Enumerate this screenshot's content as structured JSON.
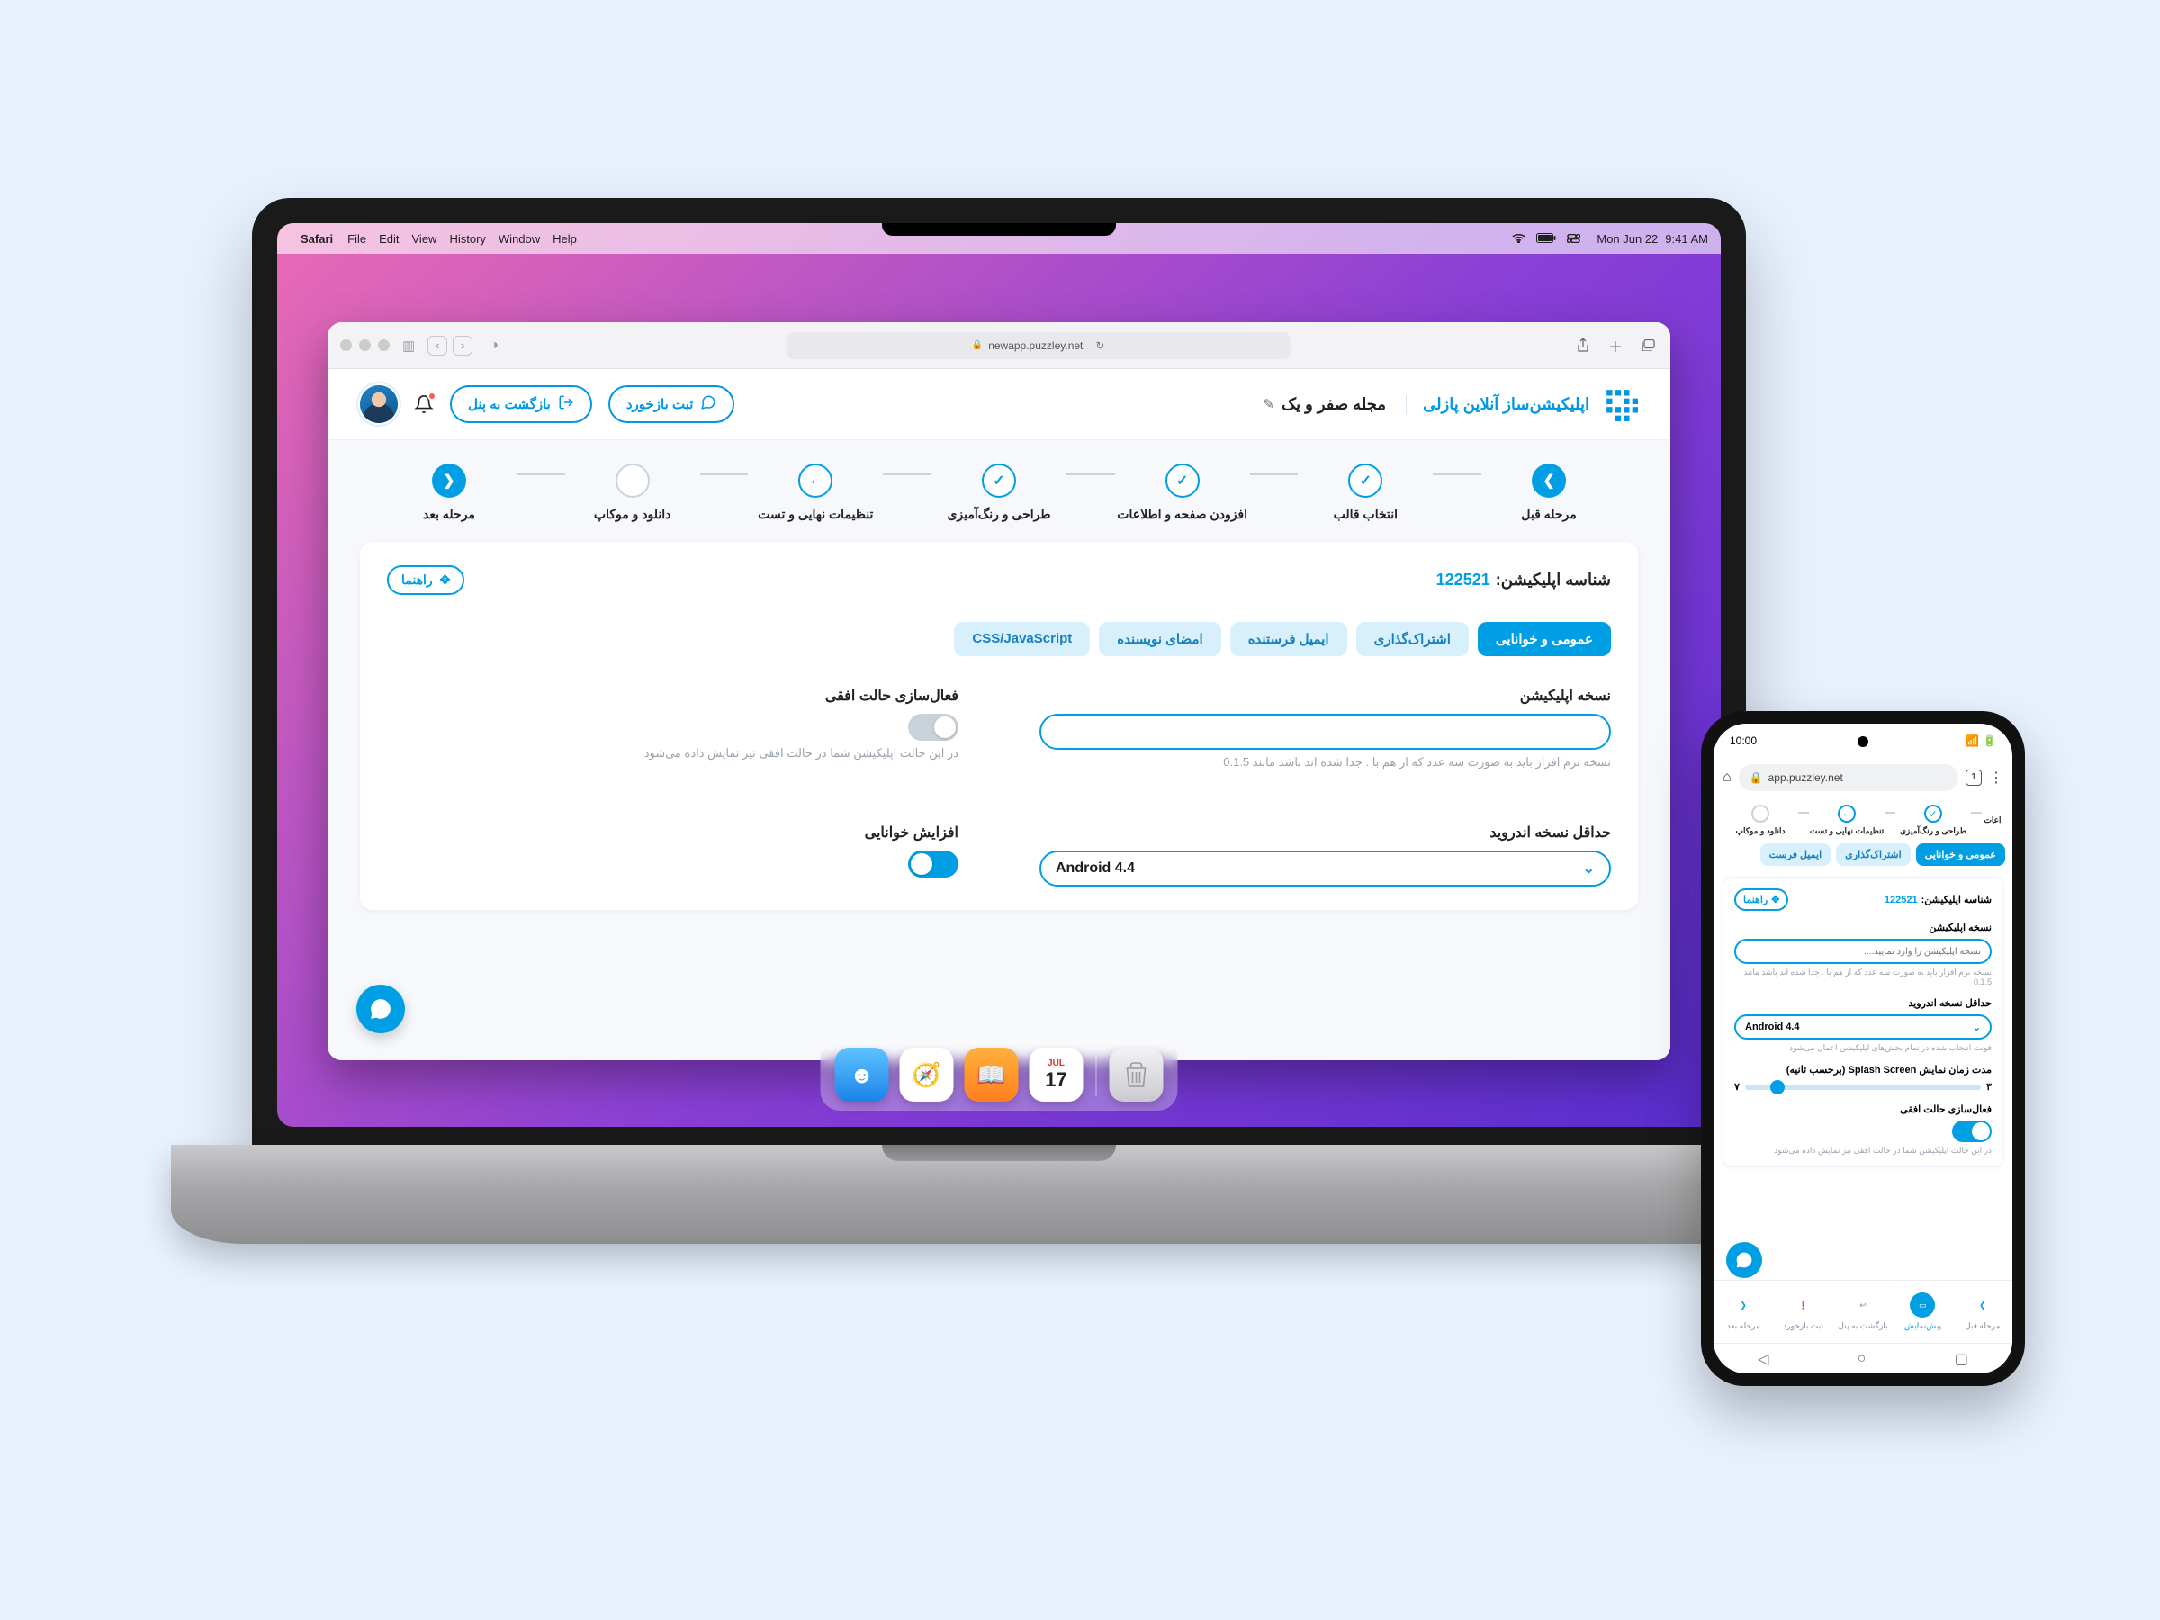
{
  "mac_menu": {
    "app": "Safari",
    "items": [
      "File",
      "Edit",
      "View",
      "History",
      "Window",
      "Help"
    ],
    "date": "Mon Jun 22",
    "time": "9:41 AM"
  },
  "safari": {
    "url": "newapp.puzzley.net"
  },
  "brand": {
    "title": "اپلیکیشن‌ساز آنلاین پازلی"
  },
  "project": {
    "title": "مجله صفر و یک"
  },
  "header": {
    "feedback": "ثبت بازخورد",
    "back_panel": "بازگشت به پنل"
  },
  "stepper": {
    "prev": "مرحله قبل",
    "next": "مرحله بعد",
    "steps": [
      "انتخاب قالب",
      "افزودن صفحه و اطلاعات",
      "طراحی و رنگ‌آمیزی",
      "تنظیمات نهایی و تست",
      "دانلود و موکاپ"
    ]
  },
  "card": {
    "appid_label": "شناسه اپلیکیشن:",
    "appid_value": "122521",
    "help": "راهنما",
    "tabs": [
      "عمومی و خوانایی",
      "اشتراک‌گذاری",
      "ایمیل فرستنده",
      "امضای نویسنده",
      "CSS/JavaScript"
    ],
    "version_label": "نسخه اپلیکیشن",
    "version_hint": "نسخه نرم افزار باید به صورت سه عدد که از هم با . جدا شده اند باشد مانند 0.1.5",
    "landscape_label": "فعال‌سازی حالت افقی",
    "landscape_hint": "در این حالت اپلیکیشن شما در حالت افقی نیز نمایش داده می‌شود",
    "min_android_label": "حداقل نسخه اندروید",
    "android_value": "Android 4.4",
    "font_hint": "فونت انتخاب شده در تمام بخش‌های اپلیکیشن اعمال می‌شود",
    "readability_label": "افزایش خوانایی",
    "splash_label": "مدت زمان نمایش Splash Screen (برحسب ثانیه)",
    "slider_min": "۳",
    "slider_max": "۷"
  },
  "phone": {
    "time": "10:00",
    "url": "app.puzzley.net",
    "tabs": [
      "عمومی و خوانایی",
      "اشتراک‌گذاری",
      "ایمیل فرست"
    ],
    "mini_steps": [
      "طراحی و رنگ‌آمیزی",
      "تنظیمات نهایی و تست",
      "دانلود و موکاپ"
    ],
    "mini_steps_extra": "اعات",
    "version_placeholder": "نسخه اپلیکیشن را وارد نمایید....",
    "bottom_nav": {
      "prev": "مرحله قبل",
      "preview": "پیش‌نمایش",
      "back": "بازگشت به پنل",
      "feedback": "ثبت بازخورد",
      "next": "مرحله بعد"
    }
  },
  "dock_cal": {
    "month": "JUL",
    "day": "17"
  }
}
